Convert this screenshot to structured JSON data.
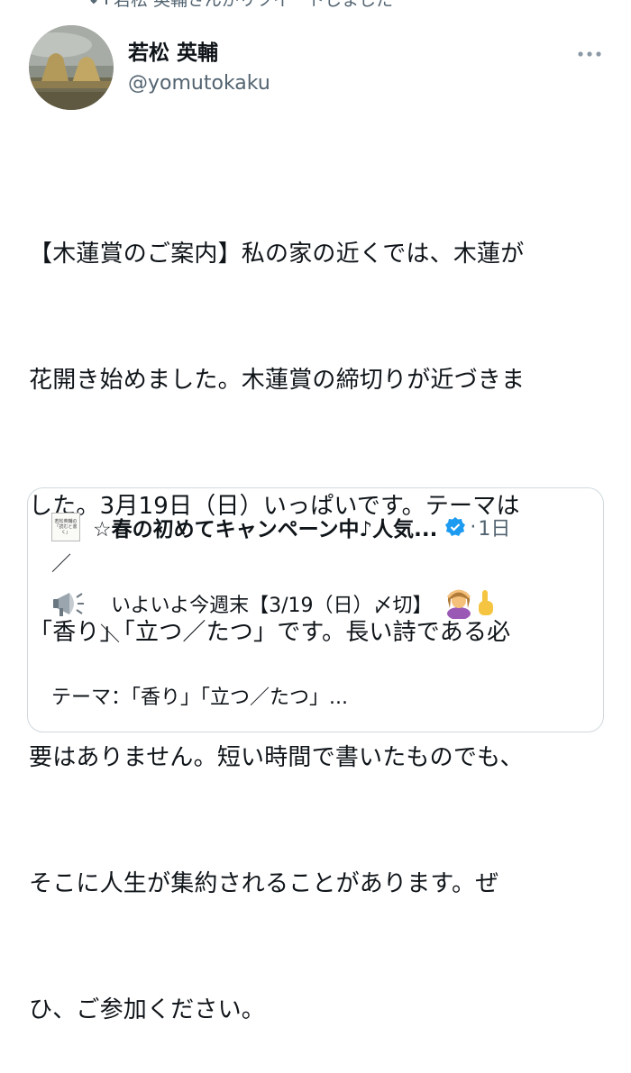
{
  "retweet": {
    "text": "若松 英輔さんがリツイートしました"
  },
  "author": {
    "display_name": "若松 英輔",
    "handle": "@yomutokaku"
  },
  "tweet": {
    "lines": [
      "【木蓮賞のご案内】私の家の近くでは、木蓮が",
      "花開き始めました。木蓮賞の締切りが近づきま",
      "した。3月19日（日）いっぱいです。テーマは",
      "「香り」「立つ／たつ」です。長い詩である必",
      "要はありません。短い時間で書いたものでも、",
      "そこに人生が集約されることがあります。ぜ",
      "ひ、ご参加ください。"
    ]
  },
  "quote": {
    "avatar_text": "若松英輔の「読むと書く」",
    "name": "☆春の初めてキャンペーン中♪人気...",
    "dot": "·",
    "time": "1日",
    "line_slash": "／",
    "announce": "いよいよ今週末【3/19（日）〆切】",
    "line_backslash": "＼",
    "theme": "テーマ：「香り」「立つ／たつ」..."
  },
  "icons": {
    "retweet": "retweet-icon",
    "more": "more-options-icon",
    "verified": "verified-badge-icon",
    "megaphone": "megaphone-icon",
    "woman": "woman-gesturing-ok-emoji",
    "finger": "index-pointing-up-emoji"
  },
  "colors": {
    "text": "#0f1419",
    "secondary": "#536471",
    "border": "#cfd9de",
    "verified": "#1d9bf0"
  }
}
